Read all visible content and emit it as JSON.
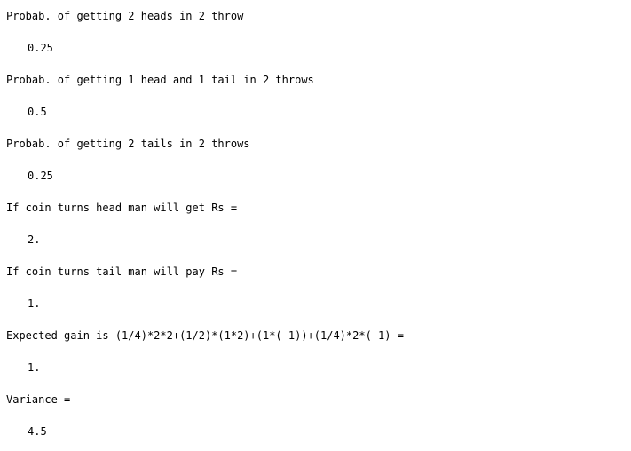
{
  "console": {
    "lines": [
      {
        "kind": "text",
        "text": "Probab. of getting 2 heads in 2 throw"
      },
      {
        "kind": "value",
        "text": "0.25"
      },
      {
        "kind": "text",
        "text": "Probab. of getting 1 head and 1 tail in 2 throws"
      },
      {
        "kind": "value",
        "text": "0.5"
      },
      {
        "kind": "text",
        "text": "Probab. of getting 2 tails in 2 throws"
      },
      {
        "kind": "value",
        "text": "0.25"
      },
      {
        "kind": "text",
        "text": "If coin turns head man will get Rs ="
      },
      {
        "kind": "value",
        "text": "2."
      },
      {
        "kind": "text",
        "text": "If coin turns tail man will pay Rs ="
      },
      {
        "kind": "value",
        "text": "1."
      },
      {
        "kind": "text",
        "text": "Expected gain is (1/4)*2*2+(1/2)*(1*2)+(1*(-1))+(1/4)*2*(-1) ="
      },
      {
        "kind": "value",
        "text": "1."
      },
      {
        "kind": "text",
        "text": "Variance ="
      },
      {
        "kind": "value",
        "text": "4.5"
      }
    ]
  }
}
